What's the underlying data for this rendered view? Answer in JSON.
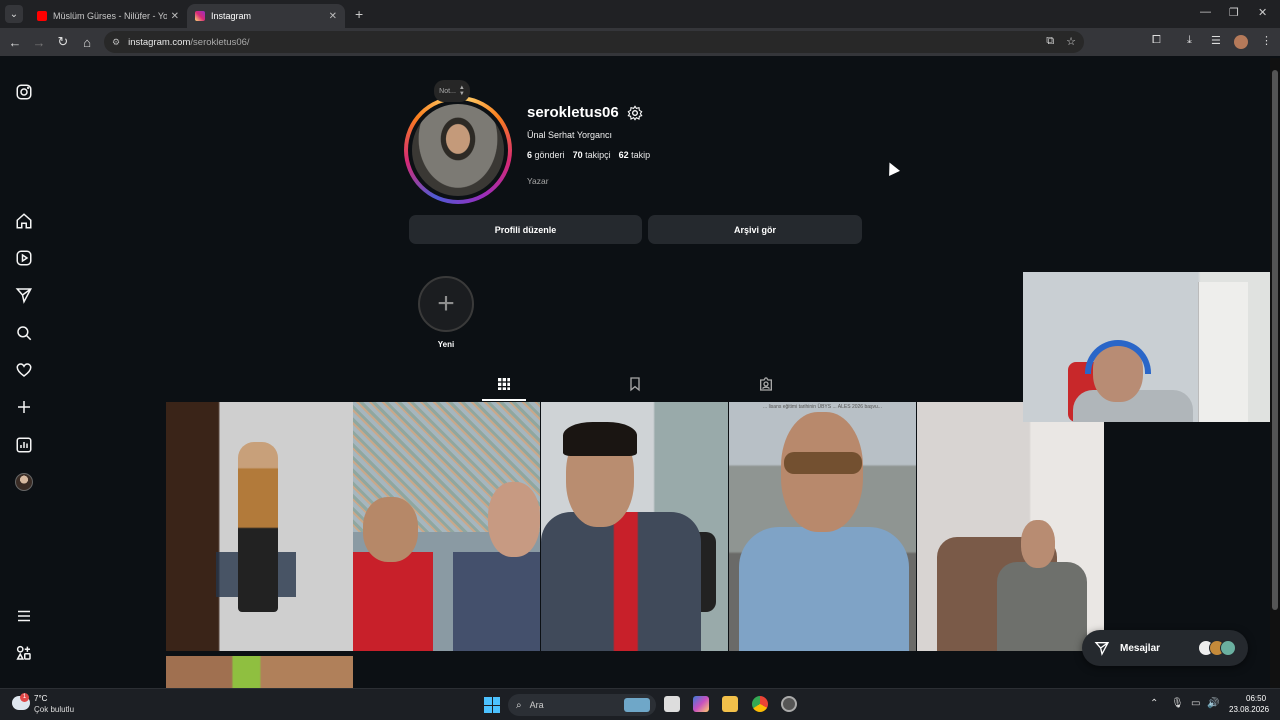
{
  "browser": {
    "tabs": [
      {
        "title": "Müslüm Gürses - Nilüfer - YouTube",
        "active": false
      },
      {
        "title": "Instagram",
        "active": true
      }
    ],
    "url_domain": "instagram.com",
    "url_path": "/serokletus06/"
  },
  "sidebar": {
    "icons": [
      "instagram-logo-icon",
      "home-icon",
      "reels-icon",
      "direct-send-icon",
      "search-icon",
      "heart-icon",
      "create-plus-icon",
      "insights-icon",
      "profile-avatar",
      "menu-icon",
      "threads-apps-icon"
    ]
  },
  "profile": {
    "note_label": "Not...",
    "username": "serokletus06",
    "full_name": "Ünal Serhat Yorgancı",
    "posts_count": "6",
    "posts_label": "gönderi",
    "followers_count": "70",
    "followers_label": "takipçi",
    "following_count": "62",
    "following_label": "takip",
    "category": "Yazar",
    "edit_button": "Profili düzenle",
    "archive_button": "Arşivi gör",
    "new_highlight_label": "Yeni"
  },
  "posts": {
    "caption_snippet": "... lisans eğitimi tarihinin ÜBYS ... ALES 2026 başvu..."
  },
  "messages": {
    "label": "Mesajlar"
  },
  "taskbar": {
    "weather_temp": "7°C",
    "weather_desc": "Çok bulutlu",
    "weather_badge": "1",
    "search_label": "Ara",
    "time": "06:50",
    "date": "23.08.2026"
  },
  "colors": {
    "background": "#0c1014",
    "button_bg": "#25292e",
    "story_ring": [
      "#feda75",
      "#fa7e1e",
      "#d62976",
      "#962fbf",
      "#4f5bd5"
    ]
  }
}
